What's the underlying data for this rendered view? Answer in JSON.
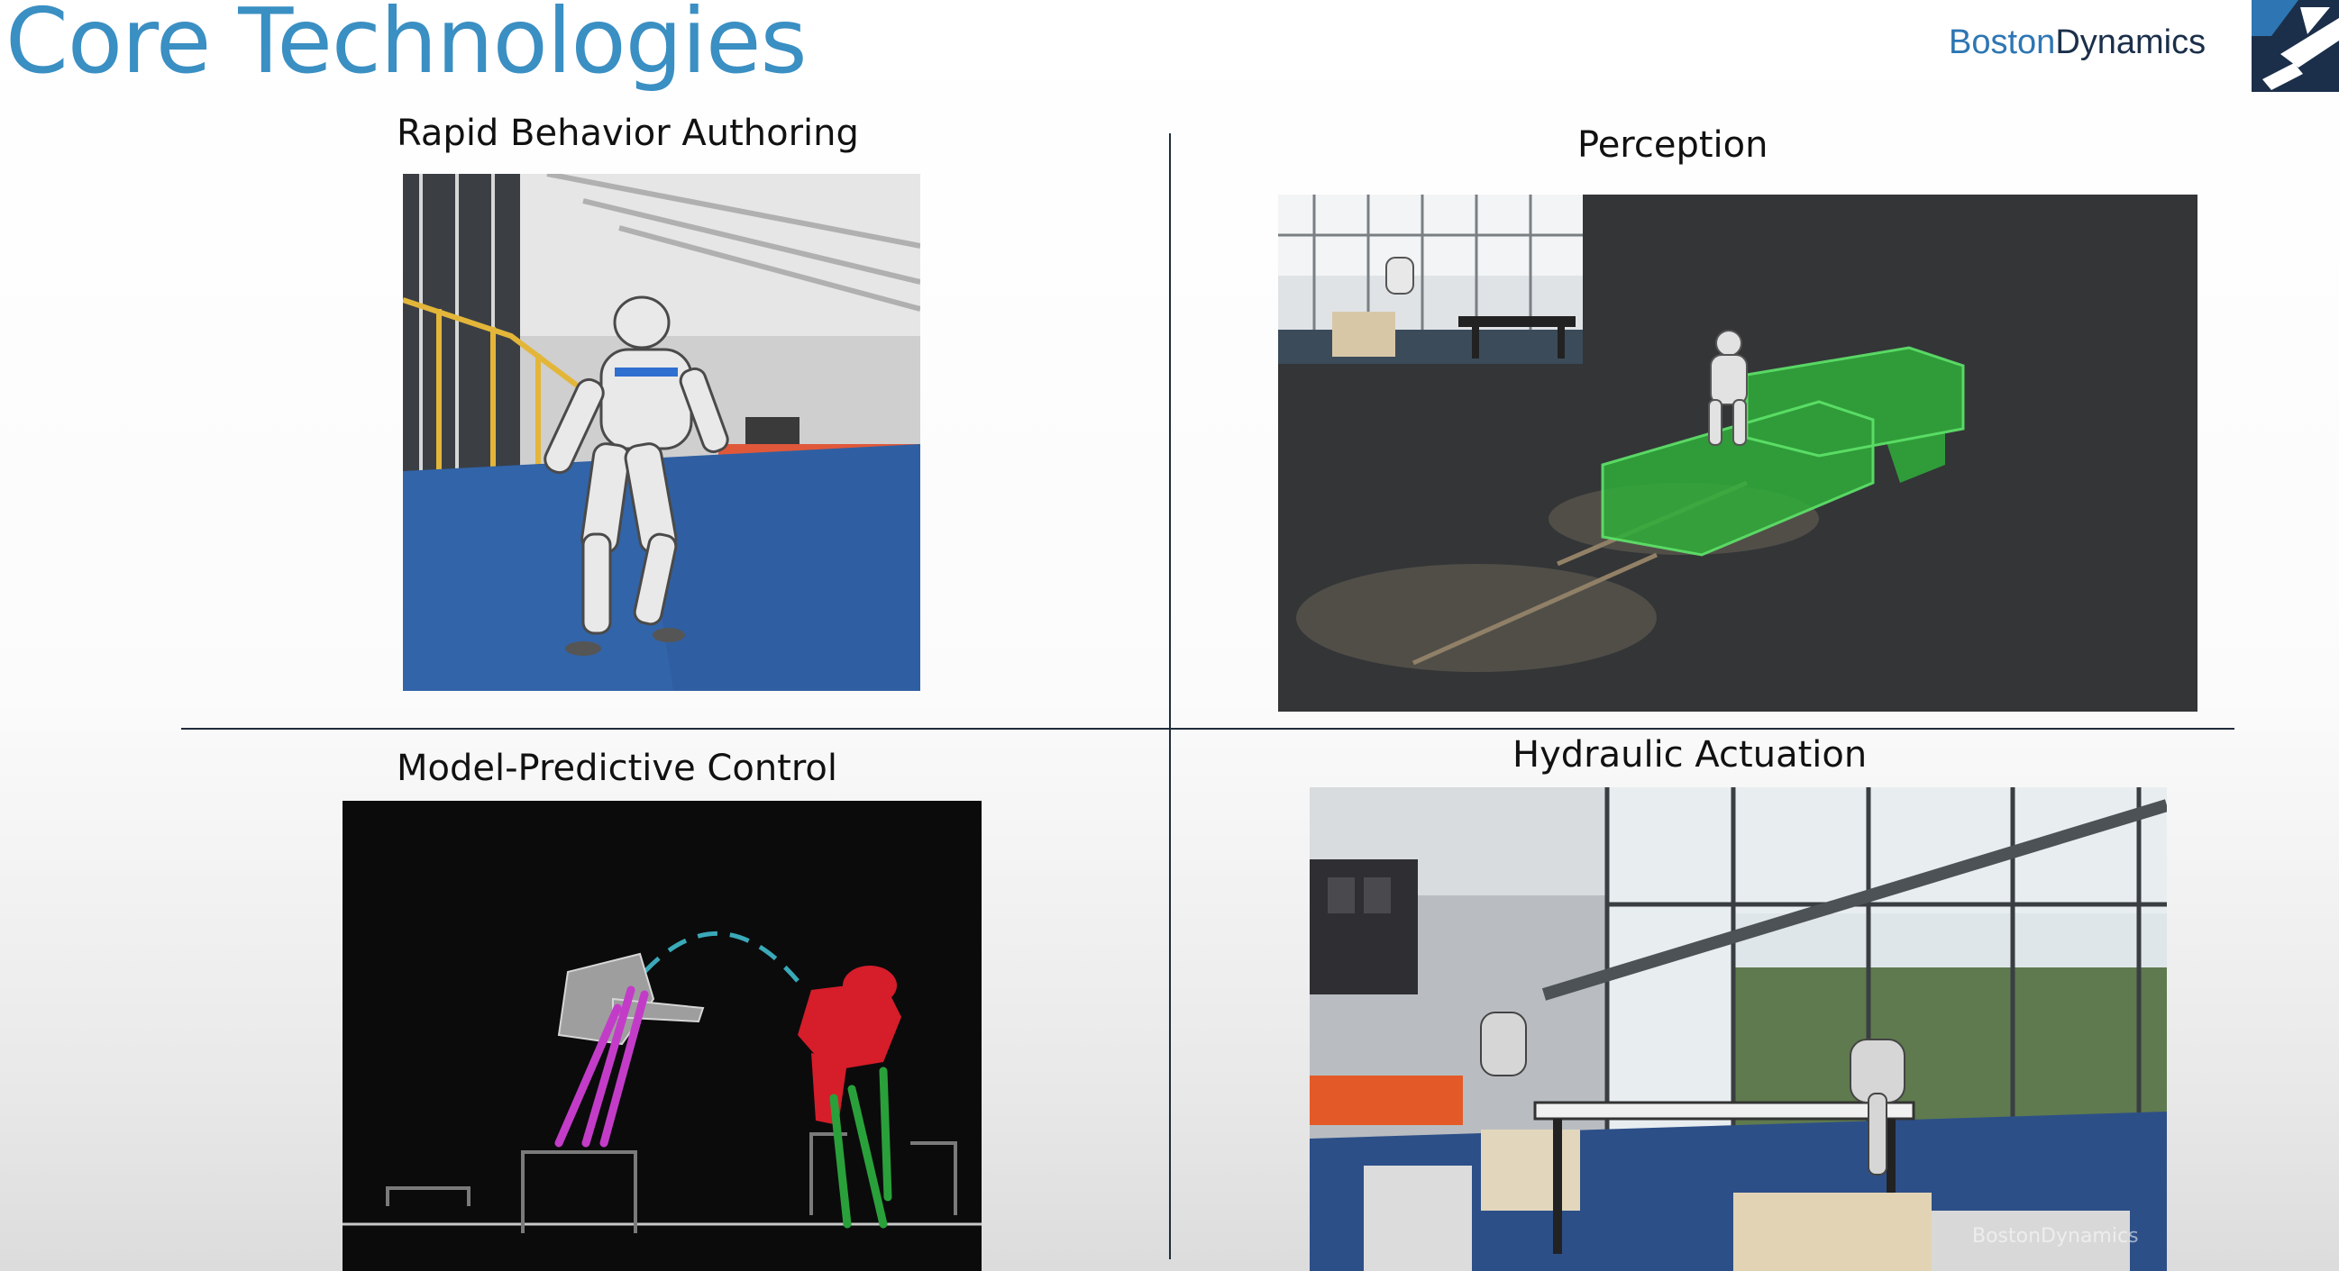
{
  "slide": {
    "title": "Core Technologies"
  },
  "brand": {
    "name_part1": "Boston",
    "name_part2": "Dynamics"
  },
  "quadrants": [
    {
      "caption": "Rapid Behavior Authoring"
    },
    {
      "caption": "Perception"
    },
    {
      "caption": "Model-Predictive Control"
    },
    {
      "caption": "Hydraulic Actuation",
      "watermark": "BostonDynamics"
    }
  ],
  "colors": {
    "title": "#3a8fc3",
    "brand_blue": "#2d76b3",
    "brand_navy": "#1b2f4a",
    "divider": "#1f2c3a"
  },
  "icons": [
    "boston-dynamics-logo-icon"
  ]
}
